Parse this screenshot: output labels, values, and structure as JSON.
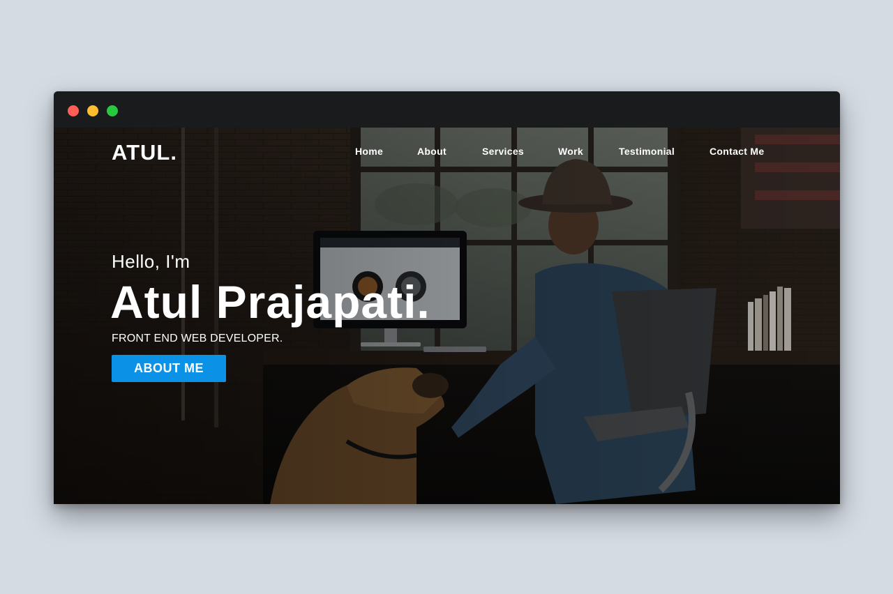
{
  "window": {
    "traffic_lights": [
      "#ff5f57",
      "#febc2e",
      "#28c840"
    ]
  },
  "header": {
    "logo": "ATUL.",
    "nav": [
      {
        "label": "Home"
      },
      {
        "label": "About"
      },
      {
        "label": "Services"
      },
      {
        "label": "Work"
      },
      {
        "label": "Testimonial"
      },
      {
        "label": "Contact Me"
      }
    ]
  },
  "hero": {
    "greeting": "Hello, I'm",
    "name": "Atul Prajapati.",
    "role": "FRONT END WEB DEVELOPER.",
    "cta_label": "ABOUT ME",
    "accent_color": "#0b92e6"
  }
}
